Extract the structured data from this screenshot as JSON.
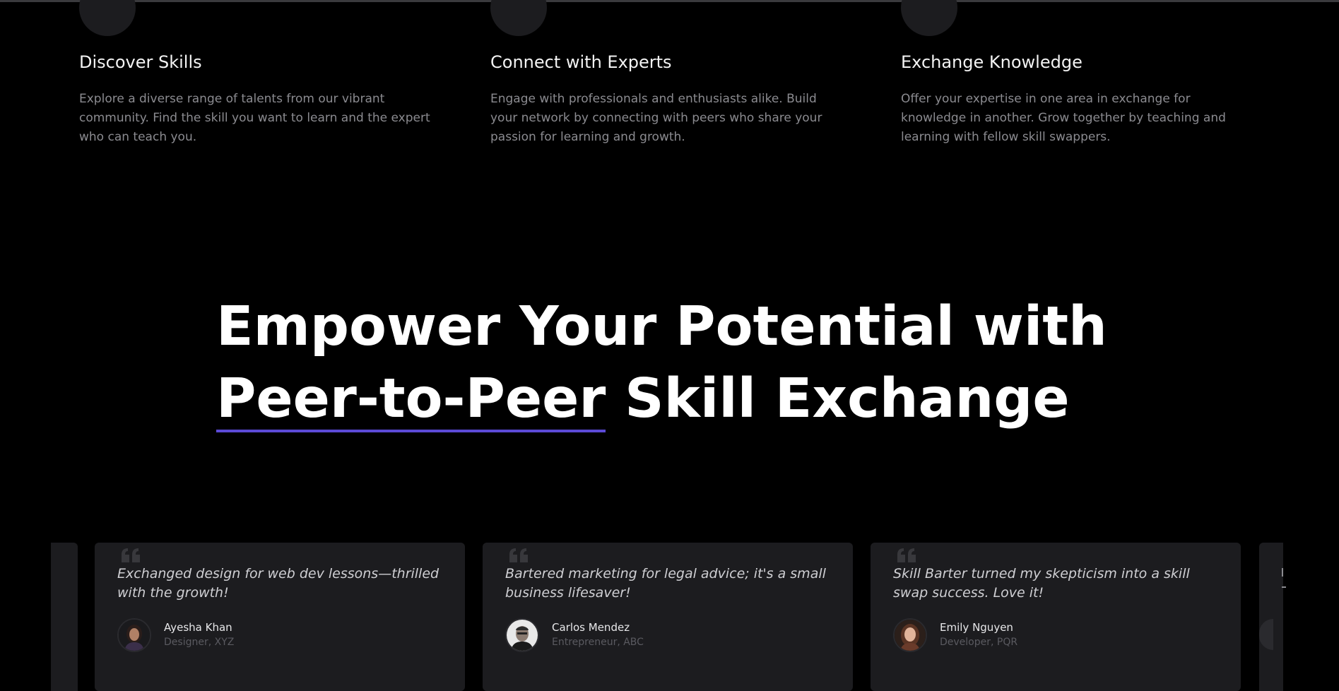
{
  "features": [
    {
      "icon": "inbox-icon",
      "title": "Discover Skills",
      "description": "Explore a diverse range of talents from our vibrant community. Find the skill you want to learn and the expert who can teach you."
    },
    {
      "icon": "chip-icon",
      "title": "Connect with Experts",
      "description": "Engage with professionals and enthusiasts alike. Build your network by connecting with peers who share your passion for learning and growth."
    },
    {
      "icon": "database-icon",
      "title": "Exchange Knowledge",
      "description": "Offer your expertise in one area in exchange for knowledge in another. Grow together by teaching and learning with fellow skill swappers."
    }
  ],
  "headline": {
    "line1": "Empower Your Potential with",
    "highlight": "Peer-to-Peer",
    "line2_rest": " Skill Exchange",
    "accent_color": "#5b4ad6"
  },
  "testimonials": [
    {
      "quote": "Exchanged design for web dev lessons—thrilled with the growth!",
      "name": "Ayesha Khan",
      "role": "Designer, XYZ"
    },
    {
      "quote": "Bartered marketing for legal advice; it's a small business lifesaver!",
      "name": "Carlos Mendez",
      "role": "Entrepreneur, ABC"
    },
    {
      "quote": "Skill Barter turned my skepticism into a skill swap success. Love it!",
      "name": "Emily Nguyen",
      "role": "Developer, PQR"
    }
  ]
}
